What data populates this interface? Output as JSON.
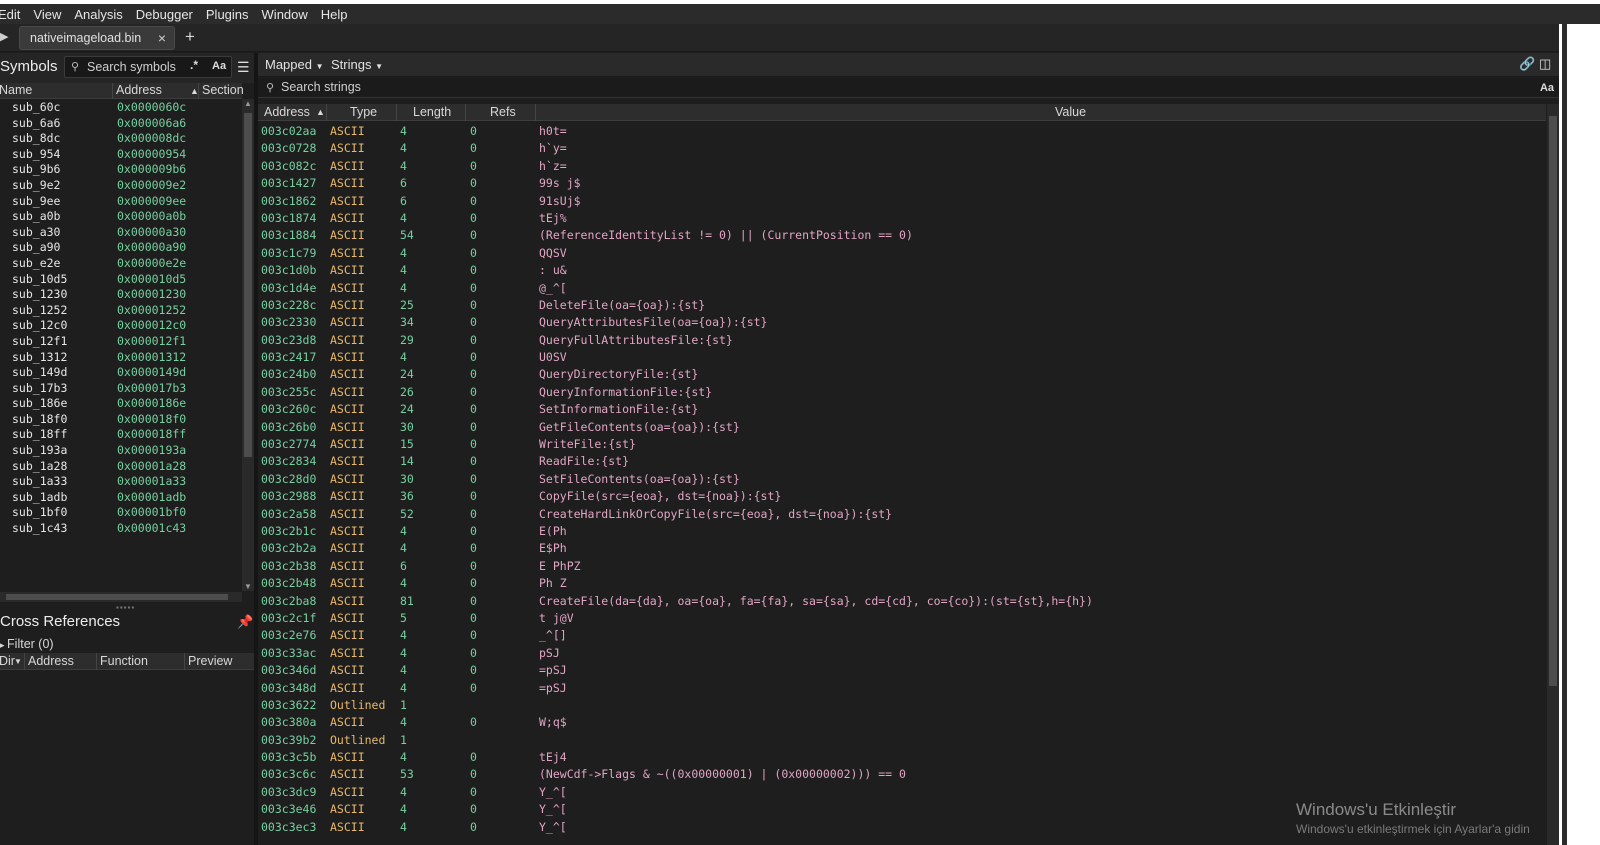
{
  "menubar": [
    "Edit",
    "View",
    "Analysis",
    "Debugger",
    "Plugins",
    "Window",
    "Help"
  ],
  "tabs": {
    "active_label": "nativeimageload.bin",
    "close_glyph": "×",
    "new_glyph": "+"
  },
  "symbols": {
    "title": "Symbols",
    "search_placeholder": "Search symbols",
    "regex_label": ".*",
    "case_label": "Aa",
    "columns": [
      "Name",
      "Address",
      "Section"
    ],
    "rows": [
      [
        "sub_60c",
        "0x0000060c"
      ],
      [
        "sub_6a6",
        "0x000006a6"
      ],
      [
        "sub_8dc",
        "0x000008dc"
      ],
      [
        "sub_954",
        "0x00000954"
      ],
      [
        "sub_9b6",
        "0x000009b6"
      ],
      [
        "sub_9e2",
        "0x000009e2"
      ],
      [
        "sub_9ee",
        "0x000009ee"
      ],
      [
        "sub_a0b",
        "0x00000a0b"
      ],
      [
        "sub_a30",
        "0x00000a30"
      ],
      [
        "sub_a90",
        "0x00000a90"
      ],
      [
        "sub_e2e",
        "0x00000e2e"
      ],
      [
        "sub_10d5",
        "0x000010d5"
      ],
      [
        "sub_1230",
        "0x00001230"
      ],
      [
        "sub_1252",
        "0x00001252"
      ],
      [
        "sub_12c0",
        "0x000012c0"
      ],
      [
        "sub_12f1",
        "0x000012f1"
      ],
      [
        "sub_1312",
        "0x00001312"
      ],
      [
        "sub_149d",
        "0x0000149d"
      ],
      [
        "sub_17b3",
        "0x000017b3"
      ],
      [
        "sub_186e",
        "0x0000186e"
      ],
      [
        "sub_18f0",
        "0x000018f0"
      ],
      [
        "sub_18ff",
        "0x000018ff"
      ],
      [
        "sub_193a",
        "0x0000193a"
      ],
      [
        "sub_1a28",
        "0x00001a28"
      ],
      [
        "sub_1a33",
        "0x00001a33"
      ],
      [
        "sub_1adb",
        "0x00001adb"
      ],
      [
        "sub_1bf0",
        "0x00001bf0"
      ],
      [
        "sub_1c43",
        "0x00001c43"
      ]
    ]
  },
  "xrefs": {
    "title": "Cross References",
    "filter_label": "Filter (0)",
    "columns": [
      "Dir",
      "Address",
      "Function",
      "Preview"
    ]
  },
  "strings_view": {
    "mapped_label": "Mapped",
    "strings_label": "Strings",
    "search_placeholder": "Search strings",
    "case_label": "Aa",
    "columns": [
      "Address",
      "Type",
      "Length",
      "Refs",
      "Value"
    ],
    "rows": [
      [
        "003c02aa",
        "ASCII",
        "4",
        "0",
        "h0t="
      ],
      [
        "003c0728",
        "ASCII",
        "4",
        "0",
        "h`y="
      ],
      [
        "003c082c",
        "ASCII",
        "4",
        "0",
        "h`z="
      ],
      [
        "003c1427",
        "ASCII",
        "6",
        "0",
        "99s j$"
      ],
      [
        "003c1862",
        "ASCII",
        "6",
        "0",
        "91sUj$"
      ],
      [
        "003c1874",
        "ASCII",
        "4",
        "0",
        "tEj%"
      ],
      [
        "003c1884",
        "ASCII",
        "54",
        "0",
        "(ReferenceIdentityList != 0) || (CurrentPosition == 0)"
      ],
      [
        "003c1c79",
        "ASCII",
        "4",
        "0",
        "QQSV"
      ],
      [
        "003c1d0b",
        "ASCII",
        "4",
        "0",
        ": u&"
      ],
      [
        "003c1d4e",
        "ASCII",
        "4",
        "0",
        "@_^["
      ],
      [
        "003c228c",
        "ASCII",
        "25",
        "0",
        "DeleteFile(oa={oa}):{st}"
      ],
      [
        "003c2330",
        "ASCII",
        "34",
        "0",
        "QueryAttributesFile(oa={oa}):{st}"
      ],
      [
        "003c23d8",
        "ASCII",
        "29",
        "0",
        "QueryFullAttributesFile:{st}"
      ],
      [
        "003c2417",
        "ASCII",
        "4",
        "0",
        "U0SV"
      ],
      [
        "003c24b0",
        "ASCII",
        "24",
        "0",
        "QueryDirectoryFile:{st}"
      ],
      [
        "003c255c",
        "ASCII",
        "26",
        "0",
        "QueryInformationFile:{st}"
      ],
      [
        "003c260c",
        "ASCII",
        "24",
        "0",
        "SetInformationFile:{st}"
      ],
      [
        "003c26b0",
        "ASCII",
        "30",
        "0",
        "GetFileContents(oa={oa}):{st}"
      ],
      [
        "003c2774",
        "ASCII",
        "15",
        "0",
        "WriteFile:{st}"
      ],
      [
        "003c2834",
        "ASCII",
        "14",
        "0",
        "ReadFile:{st}"
      ],
      [
        "003c28d0",
        "ASCII",
        "30",
        "0",
        "SetFileContents(oa={oa}):{st}"
      ],
      [
        "003c2988",
        "ASCII",
        "36",
        "0",
        "CopyFile(src={eoa}, dst={noa}):{st}"
      ],
      [
        "003c2a58",
        "ASCII",
        "52",
        "0",
        "CreateHardLinkOrCopyFile(src={eoa}, dst={noa}):{st}"
      ],
      [
        "003c2b1c",
        "ASCII",
        "4",
        "0",
        "E(Ph"
      ],
      [
        "003c2b2a",
        "ASCII",
        "4",
        "0",
        "E$Ph"
      ],
      [
        "003c2b38",
        "ASCII",
        "6",
        "0",
        "E PhPZ"
      ],
      [
        "003c2b48",
        "ASCII",
        "4",
        "0",
        "Ph Z"
      ],
      [
        "003c2ba8",
        "ASCII",
        "81",
        "0",
        "CreateFile(da={da}, oa={oa}, fa={fa}, sa={sa}, cd={cd}, co={co}):(st={st},h={h})"
      ],
      [
        "003c2c1f",
        "ASCII",
        "5",
        "0",
        "t j@V"
      ],
      [
        "003c2e76",
        "ASCII",
        "4",
        "0",
        "_^[]"
      ],
      [
        "003c33ac",
        "ASCII",
        "4",
        "0",
        "pSJ"
      ],
      [
        "003c346d",
        "ASCII",
        "4",
        "0",
        "=pSJ"
      ],
      [
        "003c348d",
        "ASCII",
        "4",
        "0",
        "=pSJ"
      ],
      [
        "003c3622",
        "Outlined",
        "1",
        "",
        ""
      ],
      [
        "003c380a",
        "ASCII",
        "4",
        "0",
        "W;q$"
      ],
      [
        "003c39b2",
        "Outlined",
        "1",
        "",
        ""
      ],
      [
        "003c3c5b",
        "ASCII",
        "4",
        "0",
        "tEj4"
      ],
      [
        "003c3c6c",
        "ASCII",
        "53",
        "0",
        "(NewCdf->Flags & ~((0x00000001) | (0x00000002))) == 0"
      ],
      [
        "003c3dc9",
        "ASCII",
        "4",
        "0",
        "Y_^["
      ],
      [
        "003c3e46",
        "ASCII",
        "4",
        "0",
        "Y_^["
      ],
      [
        "003c3ec3",
        "ASCII",
        "4",
        "0",
        "Y_^["
      ]
    ]
  },
  "watermark": {
    "line1": "Windows'u Etkinleştir",
    "line2": "Windows'u etkinleştirmek için Ayarlar'a gidin"
  },
  "colors": {
    "address": "#76d0a0",
    "type": "#e8b86a",
    "value": "#e2a5c4",
    "background": "#1e1e1e"
  }
}
